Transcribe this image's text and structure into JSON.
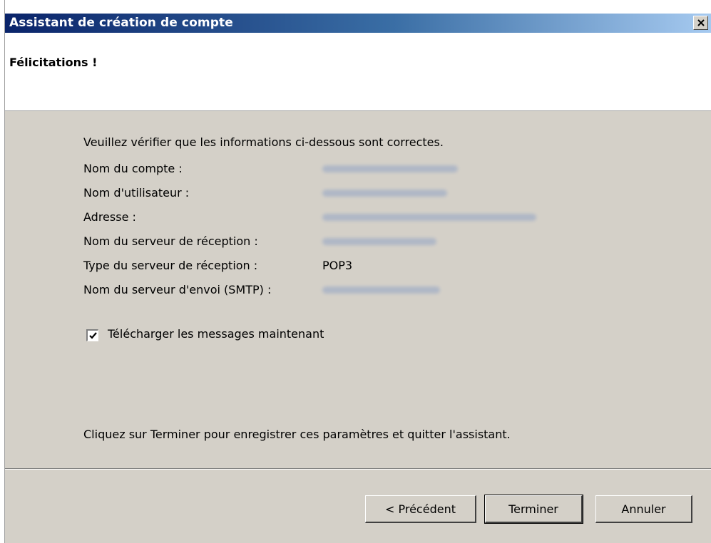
{
  "window": {
    "title": "Assistant de création de compte",
    "close_icon": "close-icon"
  },
  "header": {
    "title": "Félicitations !"
  },
  "summary": {
    "intro": "Veuillez vérifier que les informations ci-dessous sont correctes.",
    "rows": [
      {
        "label": "Nom du compte :",
        "value": ""
      },
      {
        "label": "Nom d'utilisateur :",
        "value": ""
      },
      {
        "label": "Adresse :",
        "value": ""
      },
      {
        "label": "Nom du serveur de réception :",
        "value": ""
      },
      {
        "label": "Type du serveur de réception :",
        "value": "POP3"
      },
      {
        "label": "Nom du serveur d'envoi (SMTP) :",
        "value": ""
      }
    ]
  },
  "download_checkbox": {
    "label": "Télécharger les messages maintenant",
    "checked": true
  },
  "footer": {
    "text": "Cliquez sur Terminer pour enregistrer ces paramètres et quitter l'assistant."
  },
  "buttons": {
    "previous": "< Précédent",
    "finish": "Terminer",
    "cancel": "Annuler"
  },
  "colors": {
    "titlebar_start": "#0a246a",
    "titlebar_end": "#a6caf0",
    "dialog_bg": "#d4d0c8"
  }
}
